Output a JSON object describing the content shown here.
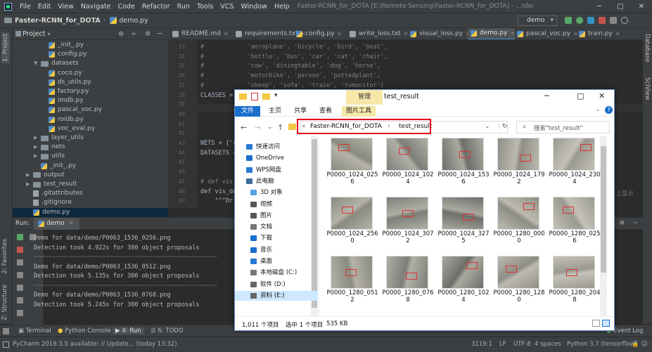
{
  "menubar": {
    "items": [
      "File",
      "Edit",
      "View",
      "Navigate",
      "Code",
      "Refactor",
      "Run",
      "Tools",
      "VCS",
      "Window",
      "Help"
    ],
    "window_title": "Faster-RCNN_for_DOTA [E:\\Remote Sensing\\Faster-RCNN_for_DOTA] - ...\\demo.py - PyCharm"
  },
  "navbar": {
    "project": "Faster-RCNN_for_DOTA",
    "file": "demo.py",
    "run_config": "demo"
  },
  "project_panel": {
    "title": "Project",
    "tree": [
      {
        "label": "_init_.py",
        "type": "py",
        "indent": 3
      },
      {
        "label": "config.py",
        "type": "py",
        "indent": 3
      },
      {
        "label": "datasets",
        "type": "folder",
        "indent": 2,
        "expanded": true
      },
      {
        "label": "coco.py",
        "type": "py",
        "indent": 3
      },
      {
        "label": "ds_utils.py",
        "type": "py",
        "indent": 3
      },
      {
        "label": "factory.py",
        "type": "py",
        "indent": 3
      },
      {
        "label": "imdb.py",
        "type": "py",
        "indent": 3
      },
      {
        "label": "pascal_voc.py",
        "type": "py",
        "indent": 3
      },
      {
        "label": "roidb.py",
        "type": "py",
        "indent": 3
      },
      {
        "label": "voc_eval.py",
        "type": "py",
        "indent": 3
      },
      {
        "label": "layer_utils",
        "type": "folder",
        "indent": 2,
        "expanded": false
      },
      {
        "label": "nets",
        "type": "folder",
        "indent": 2,
        "expanded": false
      },
      {
        "label": "utils",
        "type": "folder",
        "indent": 2,
        "expanded": false
      },
      {
        "label": "_init_.py",
        "type": "py",
        "indent": 2
      },
      {
        "label": "output",
        "type": "folder",
        "indent": 1,
        "expanded": false
      },
      {
        "label": "test_result",
        "type": "folder",
        "indent": 1,
        "expanded": false
      },
      {
        "label": ".gitattributes",
        "type": "txt",
        "indent": 1
      },
      {
        "label": ".gitignore",
        "type": "txt",
        "indent": 1
      },
      {
        "label": "demo.py",
        "type": "py",
        "indent": 1
      }
    ]
  },
  "editor_tabs": [
    "README.md",
    "requirements.txt",
    "config.py",
    "write_loss.txt",
    "visual_loss.py",
    "demo.py",
    "pascal_voc.py",
    "train.py"
  ],
  "editor_active_tab": "demo.py",
  "code": {
    "lines": [
      {
        "n": "33",
        "t": "#            'aeroplane', 'bicycle', 'bird', 'boat',"
      },
      {
        "n": "34",
        "t": "#            'bottle', 'bus', 'car', 'cat', 'chair',"
      },
      {
        "n": "35",
        "t": "#            'cow', 'diningtable', 'dog', 'horse',"
      },
      {
        "n": "36",
        "t": "#            'motorbike', 'person', 'pottedplant',"
      },
      {
        "n": "37",
        "t": "#            'sheep', 'sofa', 'train', 'tvmonitor')"
      },
      {
        "n": "38",
        "t": "CLASSES = ('__background__',"
      },
      {
        "n": "39",
        "t": ""
      },
      {
        "n": "40",
        "t": ""
      },
      {
        "n": "41",
        "t": ""
      },
      {
        "n": "42",
        "t": ""
      },
      {
        "n": "43",
        "t": "NETS = {'v"
      },
      {
        "n": "44",
        "t": "DATASETS ="
      },
      {
        "n": "45",
        "t": ""
      },
      {
        "n": "46",
        "t": ""
      },
      {
        "n": "47",
        "t": "# def vis_"
      },
      {
        "n": "48",
        "t": "def vis_de"
      },
      {
        "n": "49",
        "t": "    \"\"\"Dr"
      }
    ],
    "right_hint": "片上显示"
  },
  "run_panel": {
    "label": "Run:",
    "tab": "demo",
    "lines": [
      {
        "t": "Demo for data/demo/P0063_1536_0256.png",
        "sep": false
      },
      {
        "t": "Detection took 4.922s for 300 object proposals",
        "sep": false
      },
      {
        "t": "~~~~~~~~~~~~~~~~~~~~~~~~~~~~~~~~~~~~~~~~~~~~~~~~~~~",
        "sep": true
      },
      {
        "t": "Demo for data/demo/P0063_1536_0512.png",
        "sep": false
      },
      {
        "t": "Detection took 5.135s for 300 object proposals",
        "sep": false
      },
      {
        "t": "~~~~~~~~~~~~~~~~~~~~~~~~~~~~~~~~~~~~~~~~~~~~~~~~~~~",
        "sep": true
      },
      {
        "t": "Demo for data/demo/P0063_1536_0768.png",
        "sep": false
      },
      {
        "t": "Detection took 5.245s for 300 object proposals",
        "sep": false
      }
    ]
  },
  "left_tabs": {
    "project": "1: Project",
    "favorites": "2: Favorites",
    "structure": "Z: Structure"
  },
  "right_tabs": {
    "database": "Database",
    "scview": "SciView"
  },
  "bottom_tabs": [
    "Terminal",
    "Python Console",
    "4: Run",
    "6: TODO"
  ],
  "event_log": "Event Log",
  "status": {
    "message": "PyCharm 2019.3.5 available: // Update... (today 13:32)",
    "position": "3119:1",
    "line_sep": "LF",
    "encoding": "UTF-8",
    "indent": "4 spaces",
    "interpreter": "Python 3.7 (tensorflow)"
  },
  "explorer": {
    "manage_tab": "管理",
    "title": "test_result",
    "ribbon_tabs": [
      "文件",
      "主页",
      "共享",
      "查看",
      "图片工具"
    ],
    "address": {
      "root": "Faster-RCNN_for_DOTA",
      "sep": "›",
      "folder": "test_result"
    },
    "search_placeholder": "搜索\"test_result\"",
    "nav": [
      {
        "label": "快速访问",
        "color": "#2a7ad2",
        "indent": 0
      },
      {
        "label": "OneDrive",
        "color": "#1a6fcd",
        "indent": 0
      },
      {
        "label": "WPS网盘",
        "color": "#2a7ad2",
        "indent": 0
      },
      {
        "label": "此电脑",
        "color": "#3c6e9c",
        "indent": 0
      },
      {
        "label": "3D 对象",
        "color": "#5aa0e0",
        "indent": 1
      },
      {
        "label": "视频",
        "color": "#555",
        "indent": 1
      },
      {
        "label": "图片",
        "color": "#555",
        "indent": 1
      },
      {
        "label": "文档",
        "color": "#777",
        "indent": 1
      },
      {
        "label": "下载",
        "color": "#1a6fcd",
        "indent": 1
      },
      {
        "label": "音乐",
        "color": "#1a6fcd",
        "indent": 1
      },
      {
        "label": "桌面",
        "color": "#2a7ad2",
        "indent": 1
      },
      {
        "label": "本地磁盘 (C:)",
        "color": "#777",
        "indent": 1
      },
      {
        "label": "软件 (D:)",
        "color": "#666",
        "indent": 1
      },
      {
        "label": "资料 (E:)",
        "color": "#666",
        "indent": 1
      }
    ],
    "nav_selected": 13,
    "files": [
      "P0000_1024_0256",
      "P0000_1024_1024",
      "P0000_1024_1536",
      "P0000_1024_1792",
      "P0000_1024_2304",
      "P0000_1024_2560",
      "P0000_1024_3072",
      "P0000_1024_3275",
      "P0000_1280_0000",
      "P0000_1280_0256",
      "P0000_1280_0512",
      "P0000_1280_0768",
      "P0000_1280_1024",
      "P0000_1280_1280",
      "P0000_1280_2048"
    ],
    "status_count": "1,011 个项目",
    "status_selected": "选中 1 个项目",
    "status_size": "535 KB"
  },
  "colors": {
    "accent": "#4a88c7",
    "highlight_red": "#e4001b",
    "file_tab_blue": "#1a6fcd",
    "manage_yellow": "#f7e7a9"
  }
}
